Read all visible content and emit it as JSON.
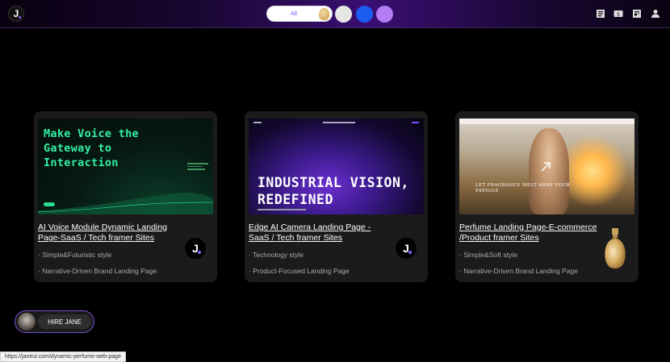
{
  "header": {
    "logo_letter": "J",
    "filter_all_label": "All",
    "icons": [
      "notes-icon",
      "ticket-icon",
      "briefcase-icon",
      "user-icon"
    ]
  },
  "colors": {
    "accent": "#8a5cff",
    "swatch_white": "#e6e6e6",
    "swatch_blue": "#1c5cf0",
    "swatch_purple": "#b47cf2"
  },
  "cards": [
    {
      "title": "AI Voice Module Dynamic Landing Page-SaaS / Tech framer Sites",
      "tag1": "· Simple&Futuristic style",
      "tag2": "· Narrative-Driven Brand Landing Page",
      "thumb_headline": "Make Voice the Gateway to Interaction",
      "badge": "J"
    },
    {
      "title": "Edge AI Camera Landing Page -SaaS / Tech framer Sites",
      "tag1": "· Technology style",
      "tag2": "· Product-Focused Landing Page",
      "thumb_headline": "INDUSTRIAL VISION, REDEFINED",
      "badge": "J"
    },
    {
      "title": "Perfume Landing Page-E-commerce /Product framer Sites",
      "tag1": "· Simple&Soft style",
      "tag2": "· Narrative-Driven Brand Landing Page",
      "thumb_headline": "LET FRAGRANCE MELT AWAY YOUR FATIGUE"
    }
  ],
  "hire_button": {
    "label": "HIRE JANE"
  },
  "status_url": "https://janeui.com/dynamic-perfume-web-page"
}
